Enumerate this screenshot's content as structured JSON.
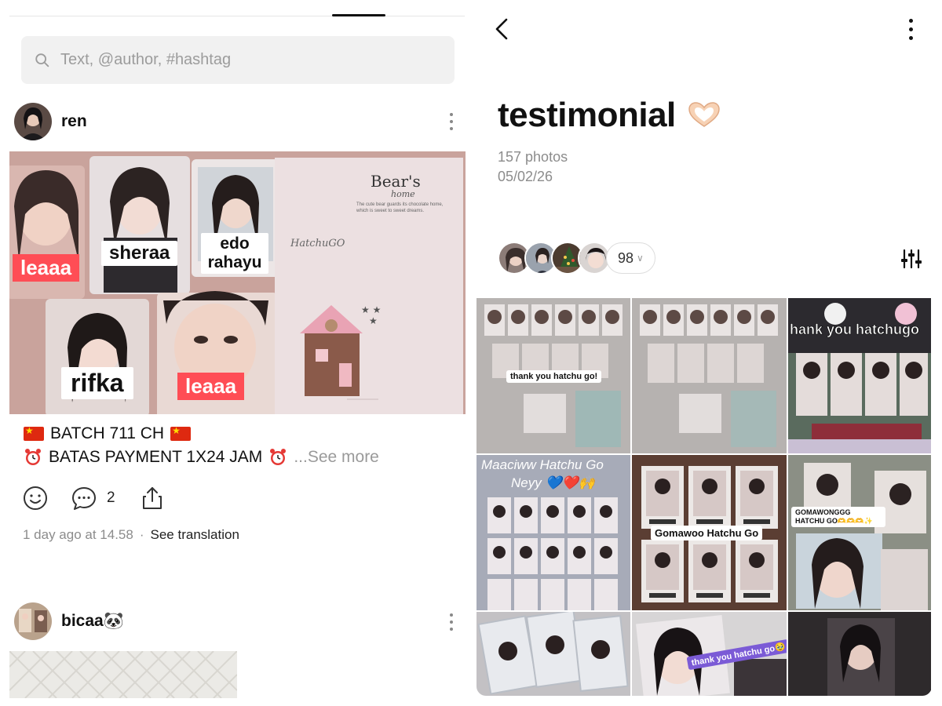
{
  "left": {
    "search_placeholder": "Text, @author, #hashtag",
    "post1": {
      "author": "ren",
      "photo_labels": [
        "leaaa",
        "sheraa",
        "edo rahayu",
        "rifka",
        "leaaa"
      ],
      "card_brand": "Bear's",
      "card_brand_sub": "home",
      "card_tagline": "The cute bear guards its chocolate home, which is sweet to sweet dreams.",
      "card_signature": "HatchuGO",
      "caption_line1": "BATCH 711 CH",
      "caption_line2": "BATAS PAYMENT 1X24 JAM",
      "see_more": "...See more",
      "comment_count": "2",
      "timestamp": "1 day ago at 14.58",
      "see_translation": "See translation"
    },
    "post2": {
      "author": "bicaa🐼"
    }
  },
  "right": {
    "album_title": "testimonial",
    "photo_count": "157 photos",
    "date": "05/02/26",
    "participants_extra": "98",
    "tile_captions": {
      "t1": "thank you hatchu go!",
      "t3": "hank you hatchugo",
      "t4": "Maaciww Hatchu Go",
      "t4b": "Neyy 💙❤️🙌",
      "t5": "Gomawoo Hatchu Go",
      "t6": "GOMAWONGGG HATCHU GO🫶🫶🫶✨",
      "t8": "thank you hatchu go🥹"
    }
  },
  "colors": {
    "accent_red_label": "#ff4d55",
    "text_muted": "#8c8c8c",
    "search_bg": "#f1f1f1"
  }
}
